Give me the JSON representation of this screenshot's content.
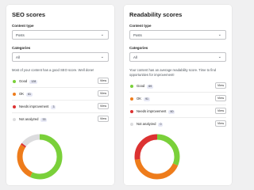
{
  "colors": {
    "good": "#7ad03a",
    "ok": "#ee7c1b",
    "needs": "#dc3232",
    "na": "#dcdcde"
  },
  "seo": {
    "title": "SEO scores",
    "content_type_label": "Content type",
    "content_type_value": "Posts",
    "categories_label": "Categories",
    "categories_value": "All",
    "description": "Most of your content has a good SEO score. Well done!",
    "view_label": "View",
    "rows": [
      {
        "label": "Good",
        "count": "128",
        "color_key": "good"
      },
      {
        "label": "OK",
        "count": "61",
        "color_key": "ok"
      },
      {
        "label": "Needs improvement",
        "count": "3",
        "color_key": "needs"
      },
      {
        "label": "Not analyzed",
        "count": "33",
        "color_key": "na"
      }
    ],
    "chart_values": [
      128,
      61,
      3,
      33
    ]
  },
  "readability": {
    "title": "Readability scores",
    "content_type_label": "Content type",
    "content_type_value": "Posts",
    "categories_label": "Categories",
    "categories_value": "All",
    "description": "Your content has an average readability score. Time to find opportunities for improvement!",
    "view_label": "View",
    "rows": [
      {
        "label": "Good",
        "count": "69",
        "color_key": "good"
      },
      {
        "label": "OK",
        "count": "91",
        "color_key": "ok"
      },
      {
        "label": "Needs improvement",
        "count": "60",
        "color_key": "needs"
      },
      {
        "label": "Not analyzed",
        "count": "0",
        "color_key": "na"
      }
    ],
    "chart_values": [
      69,
      91,
      60,
      0
    ]
  }
}
